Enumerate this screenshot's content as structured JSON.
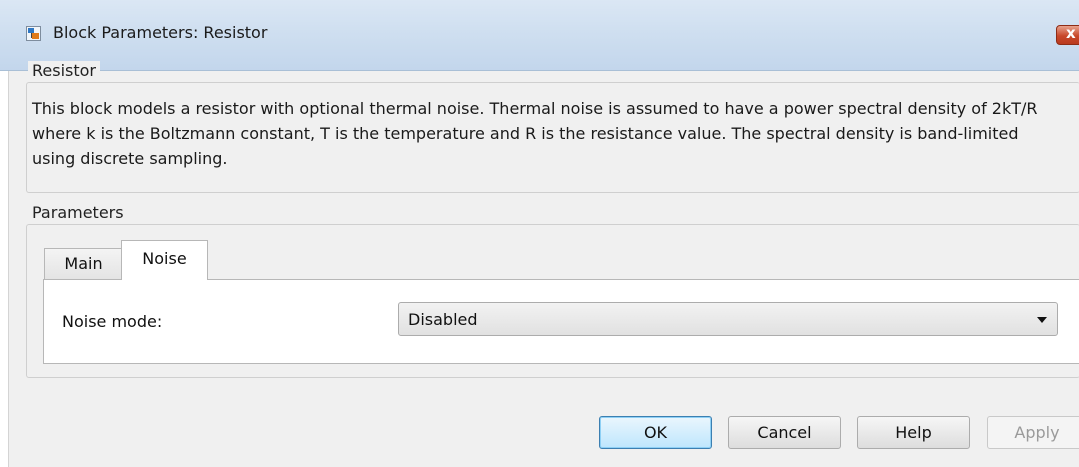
{
  "window": {
    "title": "Block Parameters: Resistor",
    "icon": "simulink-block-icon",
    "close_icon": "close-icon",
    "close_glyph": "x"
  },
  "description_group": {
    "legend": "Resistor",
    "text": "This block models a resistor with optional thermal noise. Thermal noise is assumed to have a power spectral density of 2kT/R where k is the Boltzmann constant, T is the temperature and R is the resistance value. The spectral density is band-limited using discrete sampling."
  },
  "parameters_group": {
    "legend": "Parameters",
    "tabs": [
      {
        "label": "Main",
        "active": false
      },
      {
        "label": "Noise",
        "active": true
      }
    ],
    "noise_mode": {
      "label": "Noise mode:",
      "value": "Disabled",
      "icon": "chevron-down-icon"
    }
  },
  "buttons": {
    "ok": "OK",
    "cancel": "Cancel",
    "help": "Help",
    "apply": "Apply"
  },
  "colors": {
    "title_bar": "#cfdff0",
    "dialog_bg": "#f0f0f0",
    "close_button": "#c8482a",
    "ok_border": "#3c7fb1"
  }
}
